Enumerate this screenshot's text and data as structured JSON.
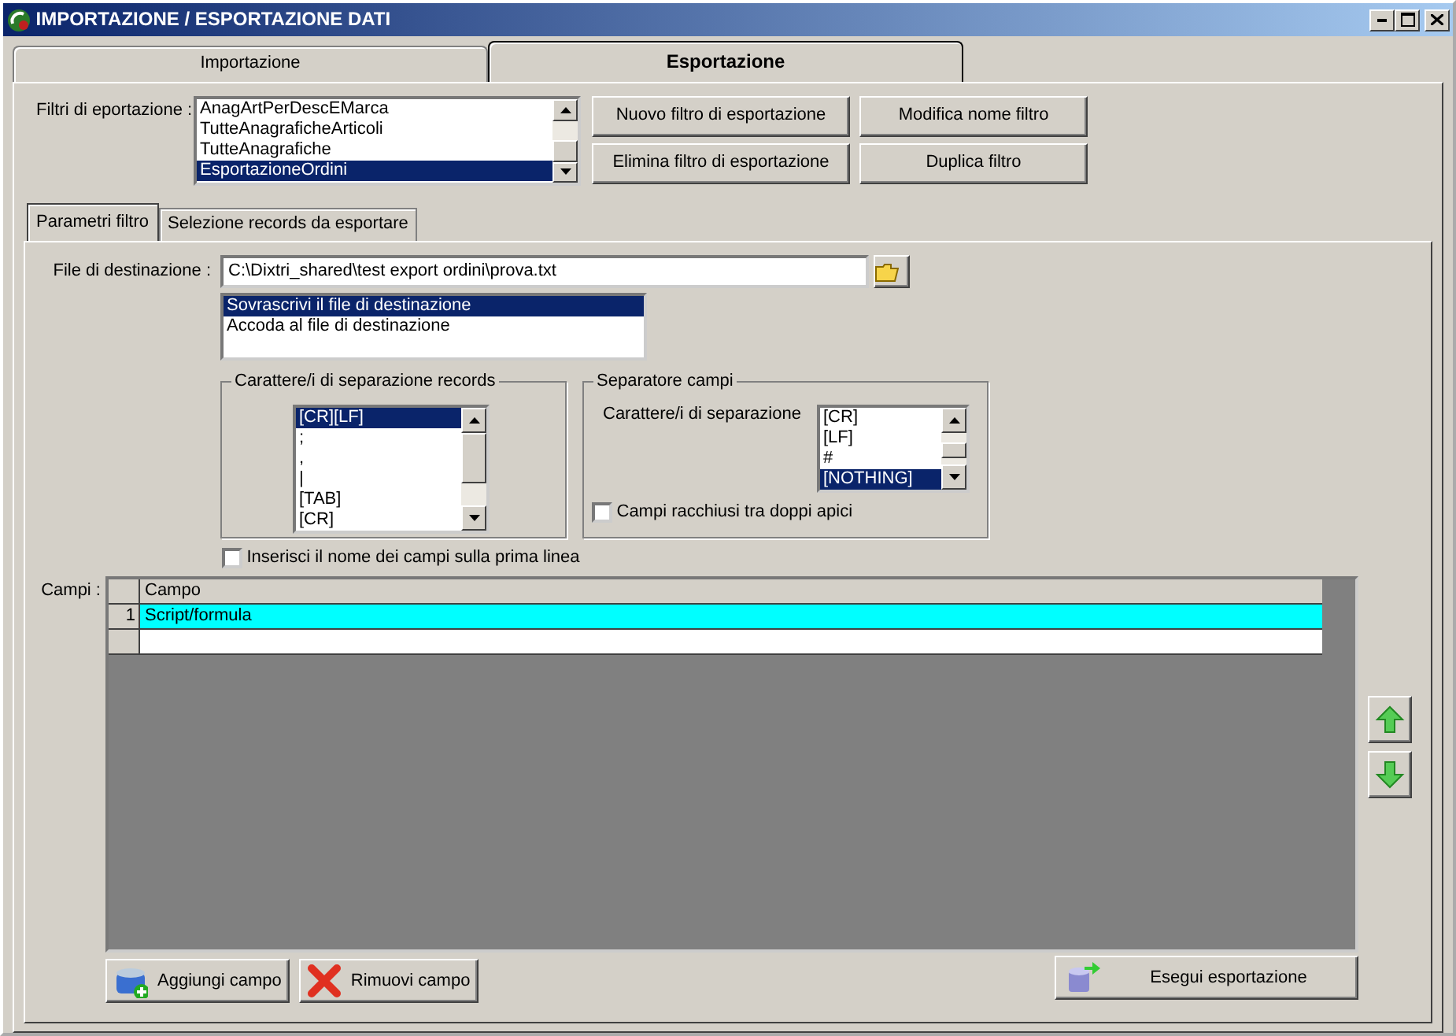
{
  "window": {
    "title": "IMPORTAZIONE / ESPORTAZIONE DATI"
  },
  "tabs": [
    {
      "label": "Importazione",
      "selected": false
    },
    {
      "label": "Esportazione",
      "selected": true
    }
  ],
  "filters": {
    "label": "Filtri di eportazione :",
    "items": [
      {
        "label": "AnagArtPerDescEMarca",
        "selected": false
      },
      {
        "label": "TutteAnagraficheArticoli",
        "selected": false
      },
      {
        "label": "TutteAnagrafiche",
        "selected": false
      },
      {
        "label": "EsportazioneOrdini",
        "selected": true
      }
    ]
  },
  "filter_buttons": [
    "Nuovo filtro di esportazione",
    "Modifica nome filtro",
    "Elimina filtro di esportazione",
    "Duplica filtro"
  ],
  "subtabs": [
    {
      "label": "Parametri filtro",
      "selected": true
    },
    {
      "label": "Selezione records da esportare",
      "selected": false
    }
  ],
  "destination": {
    "label": "File di destinazione :",
    "value": "C:\\Dixtri_shared\\test export ordini\\prova.txt"
  },
  "write_mode": [
    {
      "label": "Sovrascrivi il file di destinazione",
      "selected": true
    },
    {
      "label": "Accoda al file di destinazione",
      "selected": false
    }
  ],
  "record_separator": {
    "title": "Carattere/i di separazione records",
    "items": [
      {
        "label": "[CR][LF]",
        "selected": true
      },
      {
        "label": ";",
        "selected": false
      },
      {
        "label": ",",
        "selected": false
      },
      {
        "label": "|",
        "selected": false
      },
      {
        "label": "[TAB]",
        "selected": false
      },
      {
        "label": "[CR]",
        "selected": false
      }
    ]
  },
  "field_separator": {
    "title": "Separatore campi",
    "label": "Carattere/i di separazione",
    "items": [
      {
        "label": "[CR]",
        "selected": false
      },
      {
        "label": "[LF]",
        "selected": false
      },
      {
        "label": "#",
        "selected": false
      },
      {
        "label": "[NOTHING]",
        "selected": true
      }
    ],
    "quoted": {
      "label": "Campi racchiusi tra doppi apici",
      "checked": false
    }
  },
  "header_line": {
    "label": "Inserisci il nome dei campi sulla prima linea",
    "checked": false
  },
  "fields": {
    "label": "Campi :",
    "columns": [
      "Campo"
    ],
    "rows": [
      {
        "number": "1",
        "value": "Script/formula",
        "selected": true
      }
    ]
  },
  "actions": [
    {
      "label": "Aggiungi campo",
      "kind": "add"
    },
    {
      "label": "Rimuovi campo",
      "kind": "remove"
    },
    {
      "label": "Esegui esportazione",
      "kind": "export"
    }
  ]
}
